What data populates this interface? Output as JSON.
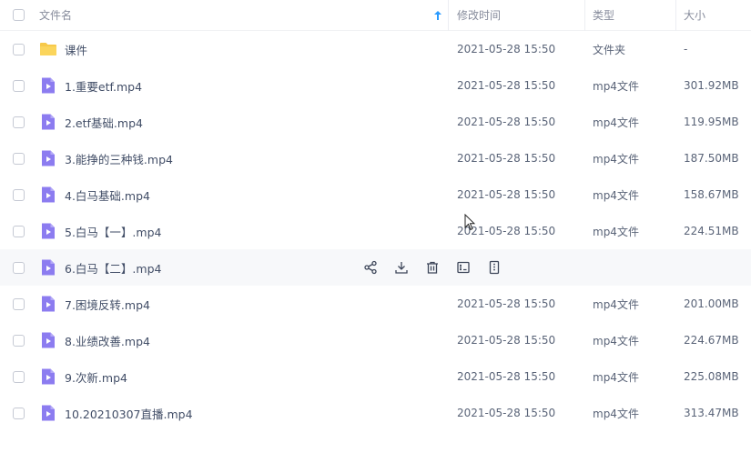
{
  "header": {
    "name": "文件名",
    "time": "修改时间",
    "type": "类型",
    "size": "大小"
  },
  "rows": [
    {
      "name": "课件",
      "time": "2021-05-28 15:50",
      "type": "文件夹",
      "size": "-",
      "icon": "folder-icon"
    },
    {
      "name": "1.重要etf.mp4",
      "time": "2021-05-28 15:50",
      "type": "mp4文件",
      "size": "301.92MB",
      "icon": "video-file-icon"
    },
    {
      "name": "2.etf基础.mp4",
      "time": "2021-05-28 15:50",
      "type": "mp4文件",
      "size": "119.95MB",
      "icon": "video-file-icon"
    },
    {
      "name": "3.能挣的三种钱.mp4",
      "time": "2021-05-28 15:50",
      "type": "mp4文件",
      "size": "187.50MB",
      "icon": "video-file-icon"
    },
    {
      "name": "4.白马基础.mp4",
      "time": "2021-05-28 15:50",
      "type": "mp4文件",
      "size": "158.67MB",
      "icon": "video-file-icon"
    },
    {
      "name": "5.白马【一】.mp4",
      "time": "2021-05-28 15:50",
      "type": "mp4文件",
      "size": "224.51MB",
      "icon": "video-file-icon"
    },
    {
      "name": "6.白马【二】.mp4",
      "time": "",
      "type": "",
      "size": "",
      "icon": "video-file-icon"
    },
    {
      "name": "7.困境反转.mp4",
      "time": "2021-05-28 15:50",
      "type": "mp4文件",
      "size": "201.00MB",
      "icon": "video-file-icon"
    },
    {
      "name": "8.业绩改善.mp4",
      "time": "2021-05-28 15:50",
      "type": "mp4文件",
      "size": "224.67MB",
      "icon": "video-file-icon"
    },
    {
      "name": "9.次新.mp4",
      "time": "2021-05-28 15:50",
      "type": "mp4文件",
      "size": "225.08MB",
      "icon": "video-file-icon"
    },
    {
      "name": "10.20210307直播.mp4",
      "time": "2021-05-28 15:50",
      "type": "mp4文件",
      "size": "313.47MB",
      "icon": "video-file-icon"
    }
  ],
  "colors": {
    "folder": "#f7c94a",
    "video": "#8c7cf0",
    "accent": "#2b9bff",
    "hover_row": "#f7f8fa"
  },
  "hover_actions": [
    "share-icon",
    "download-icon",
    "delete-icon",
    "rename-icon",
    "more-icon"
  ]
}
